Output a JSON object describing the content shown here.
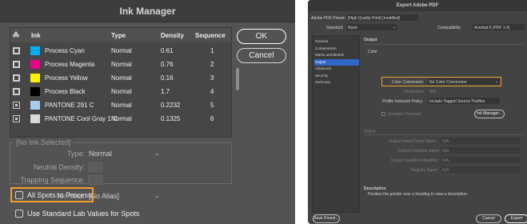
{
  "ink_manager": {
    "title": "Ink Manager",
    "columns": {
      "ink": "Ink",
      "type": "Type",
      "density": "Density",
      "sequence": "Sequence"
    },
    "rows": [
      {
        "kind": "process",
        "color": "#00aeef",
        "name": "Process Cyan",
        "type": "Normal",
        "density": "0.61",
        "sequence": "1"
      },
      {
        "kind": "process",
        "color": "#ec008c",
        "name": "Process Magenta",
        "type": "Normal",
        "density": "0.76",
        "sequence": "2"
      },
      {
        "kind": "process",
        "color": "#fff200",
        "name": "Process Yellow",
        "type": "Normal",
        "density": "0.16",
        "sequence": "3"
      },
      {
        "kind": "process",
        "color": "#000000",
        "name": "Process Black",
        "type": "Normal",
        "density": "1.7",
        "sequence": "4"
      },
      {
        "kind": "spot",
        "color": "#a8cdec",
        "name": "PANTONE 291 C",
        "type": "Normal",
        "density": "0.2232",
        "sequence": "5"
      },
      {
        "kind": "spot",
        "color": "#d9d9d6",
        "name": "PANTONE Cool Gray 1 C",
        "type": "Normal",
        "density": "0.1325",
        "sequence": "6"
      }
    ],
    "ok_label": "OK",
    "cancel_label": "Cancel",
    "no_ink_selected": "[No Ink Selected]",
    "type_label": "Type:",
    "type_value": "Normal",
    "neutral_density_label": "Neutral Density:",
    "trapping_sequence_label": "Trapping Sequence:",
    "ink_alias_label": "Ink Alias:",
    "ink_alias_value": "[No Alias]",
    "all_spots_label": "All Spots to Process",
    "all_spots_checked": false,
    "lab_values_label": "Use Standard Lab Values for Spots",
    "lab_values_checked": false,
    "highlight_color": "#f29e2a"
  },
  "export_pdf": {
    "title": "Export Adobe PDF",
    "preset_label": "Adobe PDF Preset:",
    "preset_value": "[High Quality Print] (modified)",
    "standard_label": "Standard:",
    "standard_value": "None",
    "compatibility_label": "Compatibility:",
    "compatibility_value": "Acrobat 5 (PDF 1.4)",
    "sidebar": [
      "General",
      "Compression",
      "Marks and Bleeds",
      "Output",
      "Advanced",
      "Security",
      "Summary"
    ],
    "active_index": 3,
    "section_output": "Output",
    "group_color": "Color",
    "color_conversion_label": "Color Conversion:",
    "color_conversion_value": "No Color Conversion",
    "destination_label": "Destination:",
    "destination_value": "N/A",
    "profile_inclusion_label": "Profile Inclusion Policy:",
    "profile_inclusion_value": "Include Tagged Source Profiles",
    "simulate_overprint_label": "Simulate Overprint",
    "ink_manager_button": "Ink Manager...",
    "group_pdfx": "PDF/X",
    "output_intent_label": "Output Intent Profile Name:",
    "output_intent_value": "N/A",
    "output_condition_name_label": "Output Condition Name:",
    "output_condition_name_value": "N/A",
    "output_condition_id_label": "Output Condition Identifier:",
    "output_condition_id_value": "N/A",
    "registry_name_label": "Registry Name:",
    "registry_name_value": "N/A",
    "description_heading": "Description",
    "description_text": "Position the pointer over a heading to view a description.",
    "save_preset_button": "Save Preset...",
    "cancel_button": "Cancel",
    "export_button": "Export",
    "active_color": "#2f66c8"
  }
}
